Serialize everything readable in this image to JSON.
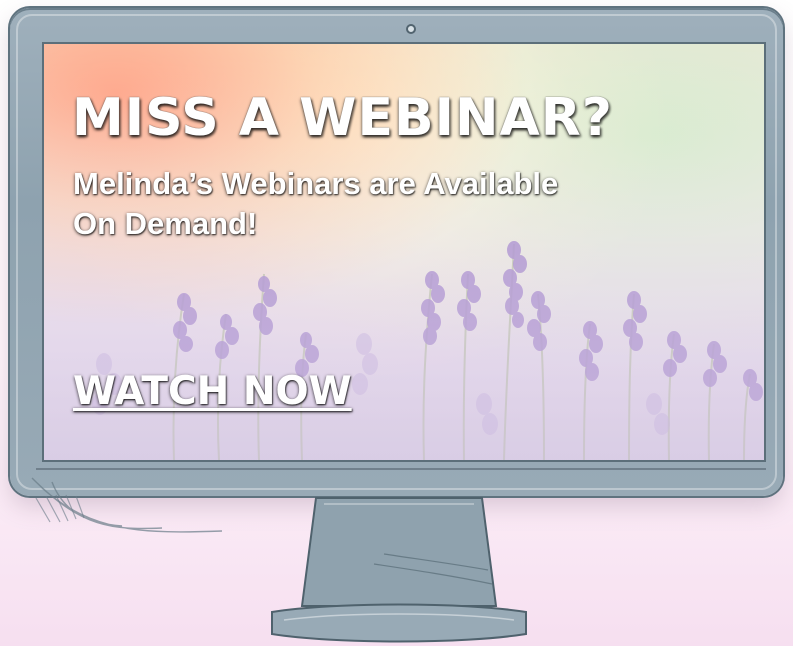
{
  "screen": {
    "headline": "MISS A WEBINAR?",
    "subline_1": "Melinda’s Webinars are Available",
    "subline_2": "On Demand!",
    "cta": "WATCH NOW"
  },
  "colors": {
    "frame": "#8ea2af",
    "frame_outline": "#5f737f",
    "text": "#ffffff",
    "lavender": "#9a7bc6",
    "background": "#f6dff0"
  },
  "icons": {
    "monitor_logo": "apple-logo-icon",
    "camera": "camera-icon"
  }
}
